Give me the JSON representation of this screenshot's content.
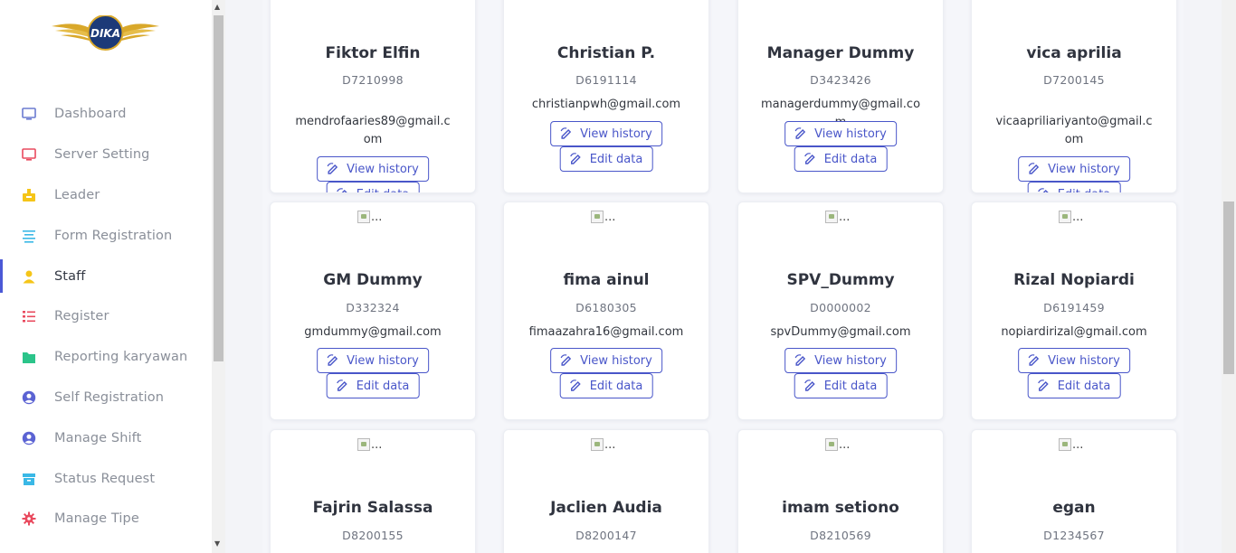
{
  "brand": {
    "logo_text": "DIKA"
  },
  "sidebar": {
    "items": [
      {
        "label": "Dashboard",
        "icon": "monitor-icon",
        "color": "#6b7bd1",
        "active": false
      },
      {
        "label": "Server Setting",
        "icon": "monitor-icon",
        "color": "#e94a5e",
        "active": false
      },
      {
        "label": "Leader",
        "icon": "leader-icon",
        "color": "#f5c518",
        "active": false
      },
      {
        "label": "Form Registration",
        "icon": "align-icon",
        "color": "#3ab8e6",
        "active": false
      },
      {
        "label": "Staff",
        "icon": "user-icon",
        "color": "#f5c518",
        "active": true
      },
      {
        "label": "Register",
        "icon": "list-icon",
        "color": "#e94a5e",
        "active": false
      },
      {
        "label": "Reporting karyawan",
        "icon": "folder-icon",
        "color": "#2bc48a",
        "active": false
      },
      {
        "label": "Self Registration",
        "icon": "user-circle-icon",
        "color": "#5b63d3",
        "active": false
      },
      {
        "label": "Manage Shift",
        "icon": "user-circle-icon",
        "color": "#5b63d3",
        "active": false
      },
      {
        "label": "Status Request",
        "icon": "archive-icon",
        "color": "#3ab8e6",
        "active": false
      },
      {
        "label": "Manage Tipe",
        "icon": "gear-icon",
        "color": "#e94a5e",
        "active": false
      }
    ]
  },
  "buttons": {
    "view_history": "View history",
    "edit_data": "Edit data"
  },
  "image_alt": "...",
  "staff": [
    {
      "name": "Fiktor Elfin",
      "code": "D7210998",
      "email": "mendrofaaries89@gmail.com"
    },
    {
      "name": "Christian P.",
      "code": "D6191114",
      "email": "christianpwh@gmail.com"
    },
    {
      "name": "Manager Dummy",
      "code": "D3423426",
      "email": "managerdummy@gmail.com"
    },
    {
      "name": "vica aprilia",
      "code": "D7200145",
      "email": "vicaapriliariyanto@gmail.com"
    },
    {
      "name": "GM Dummy",
      "code": "D332324",
      "email": "gmdummy@gmail.com"
    },
    {
      "name": "fima ainul",
      "code": "D6180305",
      "email": "fimaazahra16@gmail.com"
    },
    {
      "name": "SPV_Dummy",
      "code": "D0000002",
      "email": "spvDummy@gmail.com"
    },
    {
      "name": "Rizal Nopiardi",
      "code": "D6191459",
      "email": "nopiardirizal@gmail.com"
    },
    {
      "name": "Fajrin Salassa",
      "code": "D8200155",
      "email": ""
    },
    {
      "name": "Jaclien Audia",
      "code": "D8200147",
      "email": ""
    },
    {
      "name": "imam setiono",
      "code": "D8210569",
      "email": ""
    },
    {
      "name": "egan",
      "code": "D1234567",
      "email": ""
    }
  ]
}
